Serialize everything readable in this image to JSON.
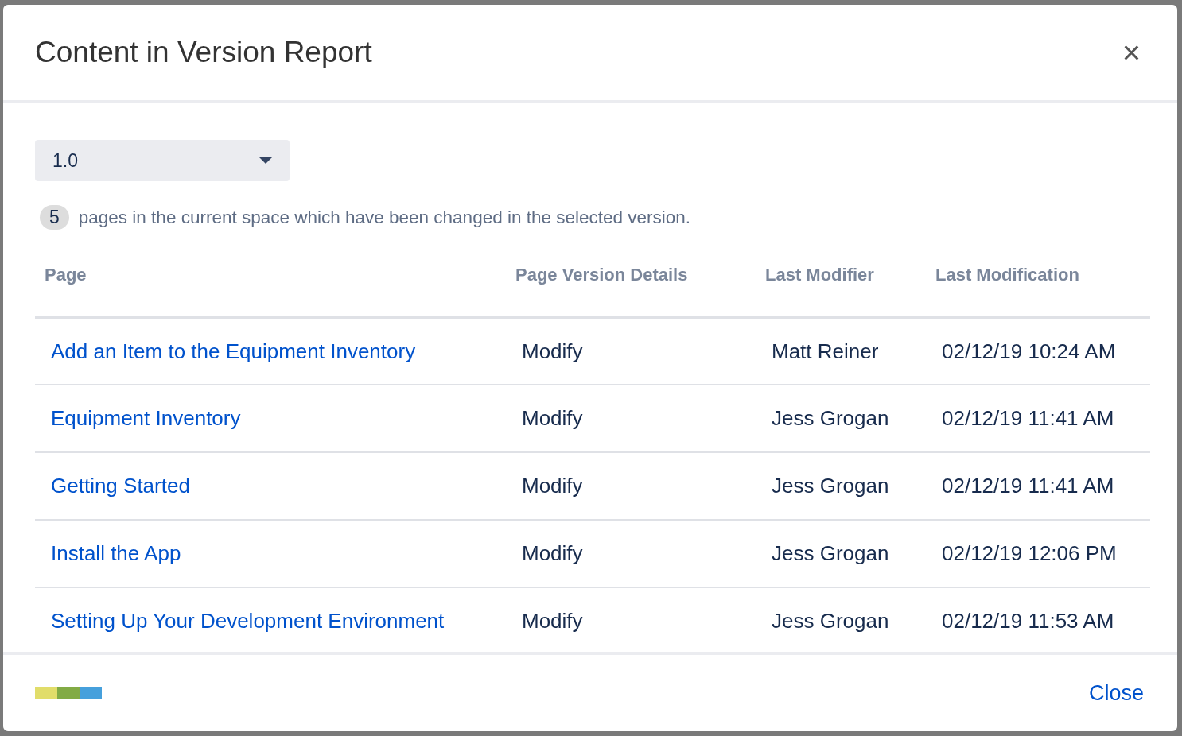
{
  "dialog": {
    "title": "Content in Version Report",
    "close_icon": "×"
  },
  "version_select": {
    "value": "1.0"
  },
  "summary": {
    "count": "5",
    "text": "pages in the current space which have been changed in the selected version."
  },
  "table": {
    "columns": [
      "Page",
      "Page Version Details",
      "Last Modifier",
      "Last Modification"
    ],
    "rows": [
      {
        "page": "Add an Item to the Equipment Inventory",
        "details": "Modify",
        "modifier": "Matt Reiner",
        "modified": "02/12/19 10:24 AM"
      },
      {
        "page": "Equipment Inventory",
        "details": "Modify",
        "modifier": "Jess Grogan",
        "modified": "02/12/19 11:41 AM"
      },
      {
        "page": "Getting Started",
        "details": "Modify",
        "modifier": "Jess Grogan",
        "modified": "02/12/19 11:41 AM"
      },
      {
        "page": "Install the App",
        "details": "Modify",
        "modifier": "Jess Grogan",
        "modified": "02/12/19 12:06 PM"
      },
      {
        "page": "Setting Up Your Development Environment",
        "details": "Modify",
        "modifier": "Jess Grogan",
        "modified": "02/12/19 11:53 AM"
      }
    ]
  },
  "footer": {
    "close_button": "Close"
  }
}
